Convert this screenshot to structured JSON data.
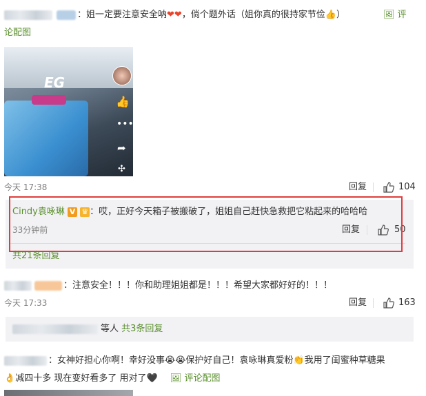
{
  "comment1": {
    "text": "：姐一定要注意安全呐",
    "text2": "，倘个题外话（姐你真的很持家节俭",
    "text3": "）",
    "pic_link_a": "评",
    "pic_link_b": "论配图",
    "time": "今天 17:38",
    "reply_label": "回复",
    "likes": "104"
  },
  "reply1": {
    "author": "Cindy袁咏琳",
    "text": "：哎，正好今天箱子被搬破了，姐姐自己赶快急救把它粘起来的哈哈哈",
    "time": "33分钟前",
    "reply_label": "回复",
    "likes": "50",
    "more_replies": "共21条回复"
  },
  "comment2": {
    "text": "：注意安全！！！你和助理姐姐都是！！！希望大家都好好的！！！",
    "time": "今天 17:33",
    "reply_label": "回复",
    "likes": "163",
    "reply_summary_tail": "等人",
    "reply_count": "共3条回复"
  },
  "comment3": {
    "text_a": "：女神好担心你啊！幸好没事",
    "text_b": "保护好自己！袁咏琳真爱粉",
    "text_c": "我用了闺蜜种草糖果",
    "line2": "减四十多 现在变好看多了 用对了",
    "pic_link": "评论配图"
  },
  "image_overlay_text": "EG",
  "colors": {
    "link": "#5a8f2c",
    "highlight_box": "#e03c3c",
    "reply_bg": "#f2f2f5"
  }
}
